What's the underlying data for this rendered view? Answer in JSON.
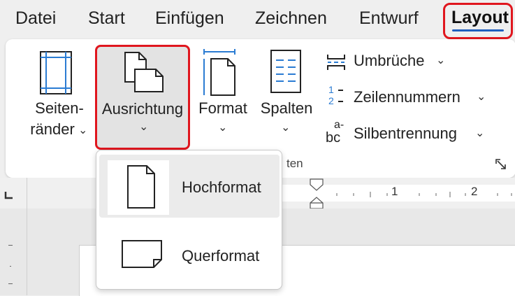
{
  "tabs": [
    "Datei",
    "Start",
    "Einfügen",
    "Zeichnen",
    "Entwurf"
  ],
  "active_tab": "Layout",
  "ribbon": {
    "margins_label_1": "Seiten-",
    "margins_label_2": "ränder",
    "orientation_label": "Ausrichtung",
    "format_label": "Format",
    "columns_label": "Spalten",
    "breaks_label": "Umbrüche",
    "line_numbers_label": "Zeilennummern",
    "hyphenation_label": "Silbentrennung",
    "group_label_fragment": "ten",
    "line_numbers_glyph_top": "1",
    "line_numbers_glyph_bottom": "2",
    "hyphen_glyph_top": "a-",
    "hyphen_glyph_bottom": "bc"
  },
  "orientation_menu": {
    "options": [
      {
        "label": "Hochformat",
        "selected": true
      },
      {
        "label": "Querformat",
        "selected": false
      }
    ]
  },
  "ruler": {
    "numbers": [
      "1",
      "2"
    ]
  },
  "colors": {
    "highlight_red": "#e0161e",
    "accent_blue": "#1f5fbf",
    "icon_blue": "#2b7cd3"
  }
}
